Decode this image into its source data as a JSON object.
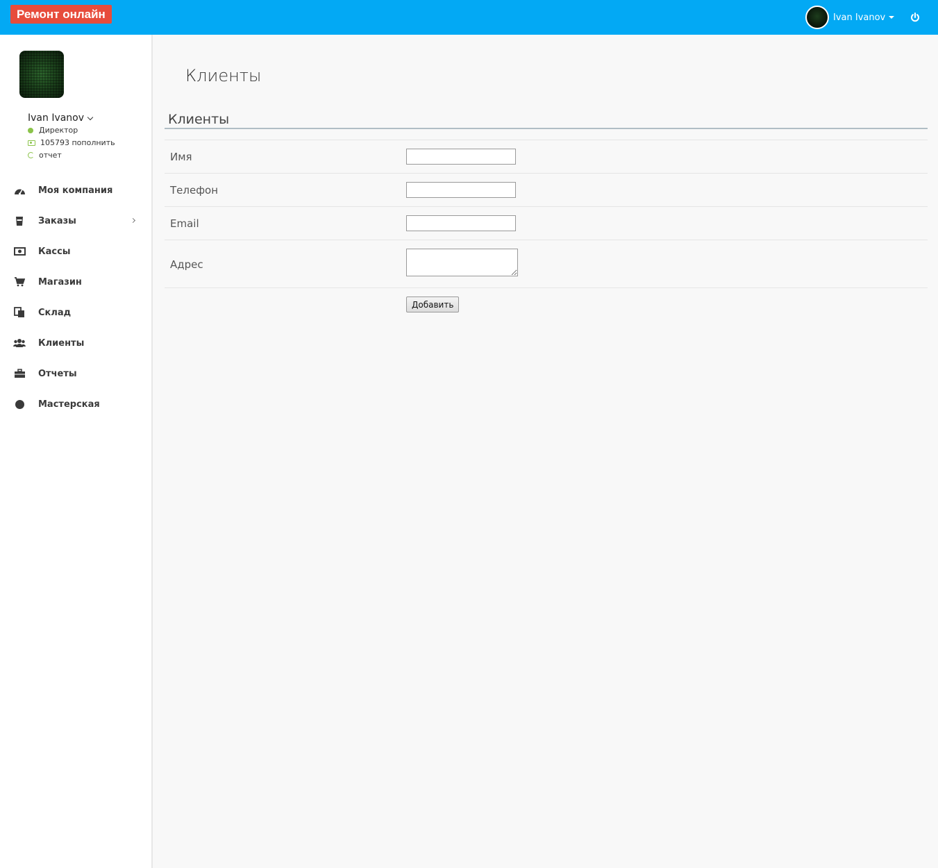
{
  "header": {
    "brand": "Ремонт онлайн",
    "user_name": "Ivan Ivanov"
  },
  "sidebar": {
    "profile": {
      "name": "Ivan Ivanov",
      "role": "Директор",
      "balance": "105793 пополнить",
      "report": "отчет"
    },
    "items": [
      {
        "label": "Моя компания",
        "icon": "dashboard-icon"
      },
      {
        "label": "Заказы",
        "icon": "cup-icon",
        "has_submenu": true
      },
      {
        "label": "Кассы",
        "icon": "money-icon"
      },
      {
        "label": "Магазин",
        "icon": "cart-icon"
      },
      {
        "label": "Склад",
        "icon": "copy-icon"
      },
      {
        "label": "Клиенты",
        "icon": "users-icon"
      },
      {
        "label": "Отчеты",
        "icon": "briefcase-icon"
      },
      {
        "label": "Мастерская",
        "icon": "circle-icon"
      }
    ]
  },
  "main": {
    "page_title": "Клиенты",
    "section_title": "Клиенты",
    "form": {
      "name_label": "Имя",
      "name_value": "",
      "phone_label": "Телефон",
      "phone_value": "",
      "email_label": "Email",
      "email_value": "",
      "address_label": "Адрес",
      "address_value": "",
      "submit_label": "Добавить"
    }
  },
  "colors": {
    "topbar": "#03a9f4",
    "brand_bg": "#e74c3c",
    "status_green": "#8bc34a"
  }
}
